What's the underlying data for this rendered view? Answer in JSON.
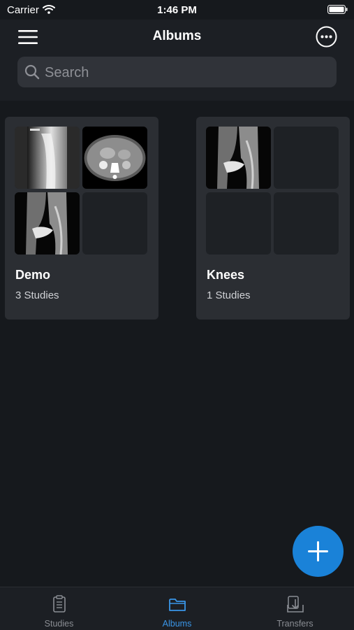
{
  "status_bar": {
    "carrier": "Carrier",
    "time": "1:46 PM"
  },
  "header": {
    "title": "Albums"
  },
  "search": {
    "placeholder": "Search"
  },
  "albums": [
    {
      "name": "Demo",
      "count": "3 Studies"
    },
    {
      "name": "Knees",
      "count": "1 Studies"
    }
  ],
  "tabs": [
    {
      "label": "Studies",
      "icon": "clipboard-icon"
    },
    {
      "label": "Albums",
      "icon": "folder-icon"
    },
    {
      "label": "Transfers",
      "icon": "download-tray-icon"
    }
  ],
  "colors": {
    "accent": "#1a82d8",
    "active_tab": "#3a96e8",
    "background": "#16191d",
    "card": "#2b2e33"
  }
}
